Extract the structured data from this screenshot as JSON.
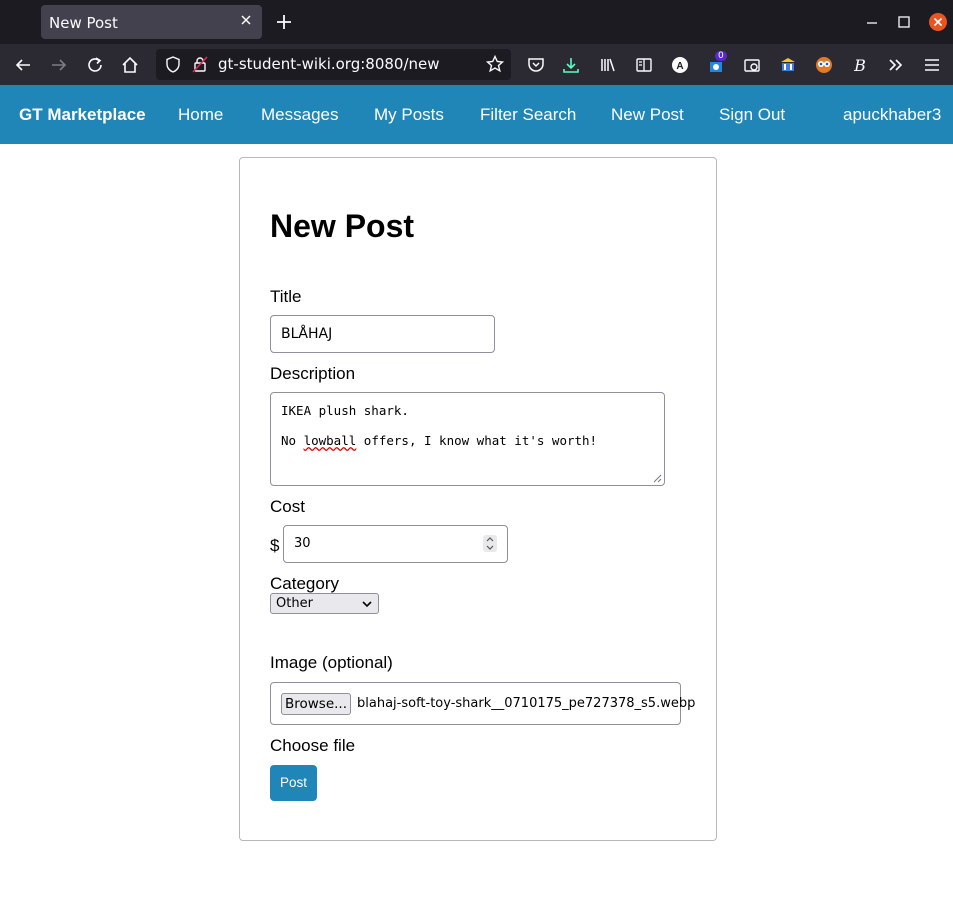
{
  "browser": {
    "tab_title": "New Post",
    "url": "gt-student-wiki.org:8080/new",
    "extension_badge": "0"
  },
  "site": {
    "brand": "GT Marketplace",
    "nav": [
      "Home",
      "Messages",
      "My Posts",
      "Filter Search",
      "New Post",
      "Sign Out"
    ],
    "user": "apuckhaber3"
  },
  "form": {
    "heading": "New Post",
    "title_label": "Title",
    "title_value": "BLÅHAJ",
    "description_label": "Description",
    "description_line1": "IKEA plush shark.",
    "description_line2_pre": "No ",
    "description_line2_misspelled": "lowball",
    "description_line2_post": " offers, I know what it's worth!",
    "cost_label": "Cost",
    "currency_symbol": "$",
    "cost_value": "30",
    "category_label": "Category",
    "category_selected": "Other",
    "image_label": "Image (optional)",
    "browse_label": "Browse...",
    "file_name": "blahaj-soft-toy-shark__0710175_pe727378_s5.webp",
    "choose_file_label": "Choose file",
    "submit_label": "Post"
  },
  "colors": {
    "site_nav": "#1f86b7",
    "chrome_dark": "#1c1b22",
    "chrome_toolbar": "#2b2a33"
  }
}
